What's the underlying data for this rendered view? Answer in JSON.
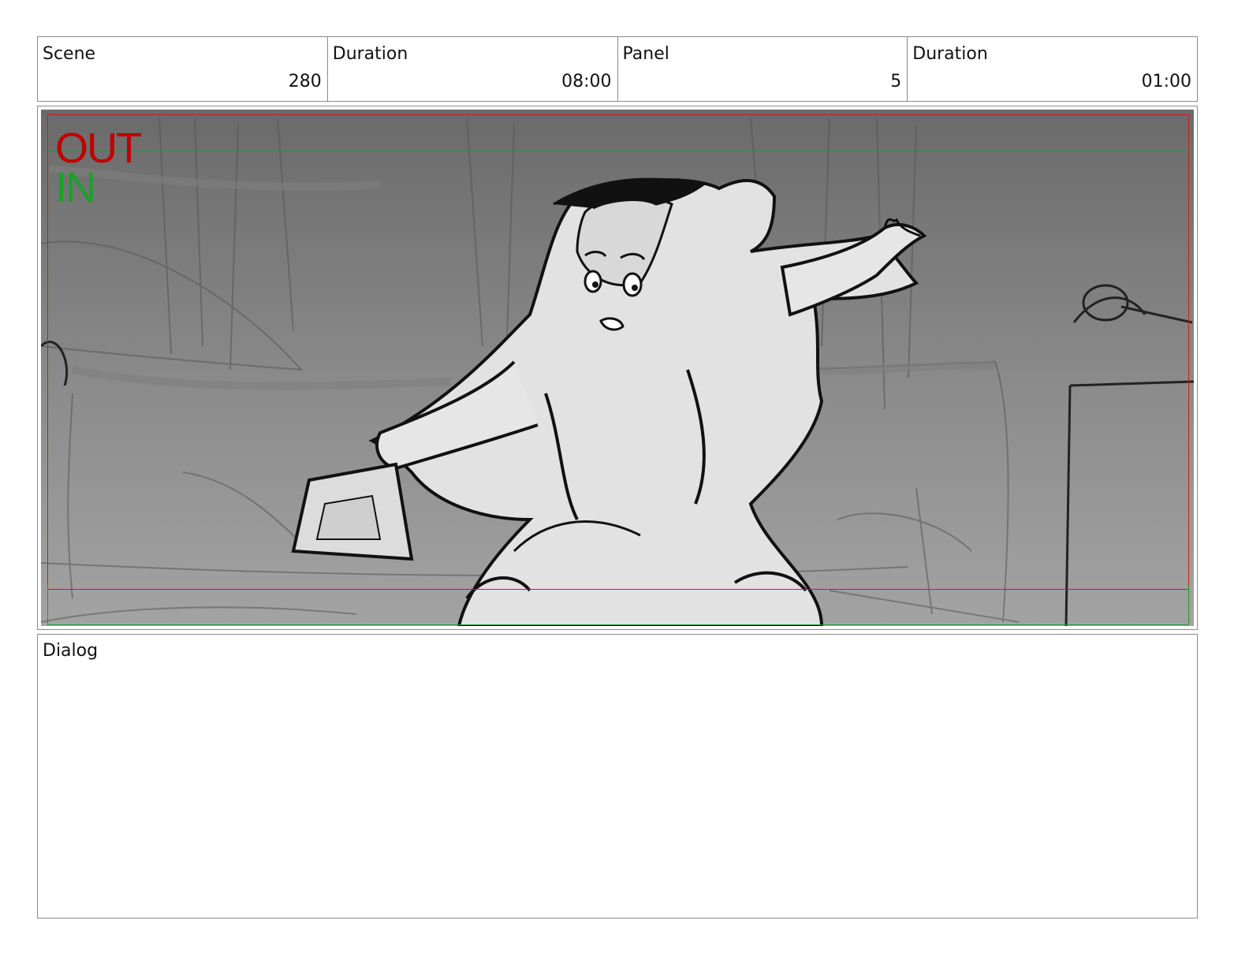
{
  "header": {
    "scene_label": "Scene",
    "scene_value": "280",
    "scene_duration_label": "Duration",
    "scene_duration_value": "08:00",
    "panel_label": "Panel",
    "panel_value": "5",
    "panel_duration_label": "Duration",
    "panel_duration_value": "01:00"
  },
  "panel": {
    "out_label": "OUT",
    "in_label": "IN",
    "colors": {
      "out": "#c00000",
      "in": "#1aa12a"
    }
  },
  "dialog": {
    "label": "Dialog",
    "text": ""
  }
}
